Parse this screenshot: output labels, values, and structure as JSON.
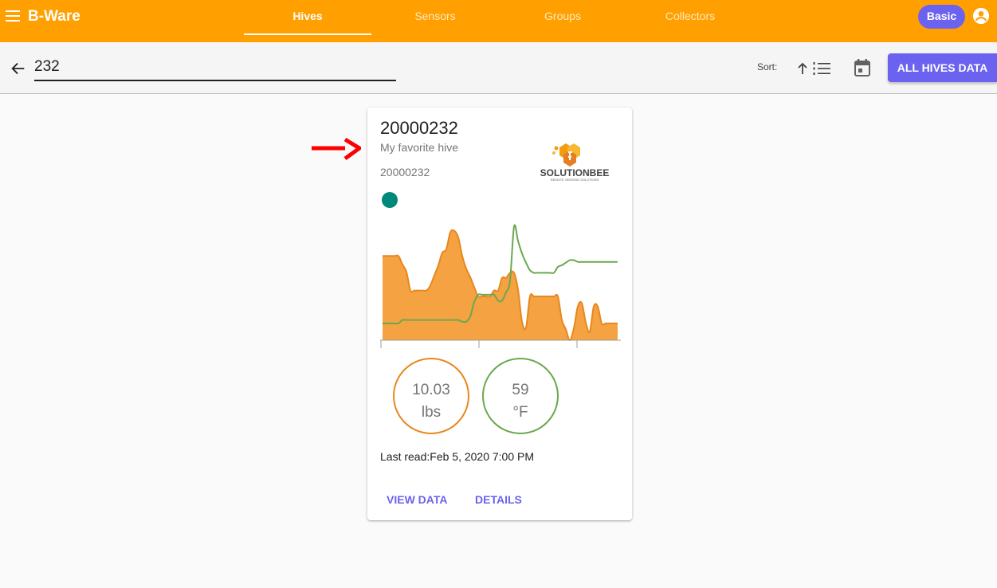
{
  "appbar": {
    "title": "B-Ware",
    "tabs": [
      {
        "label": "Hives",
        "active": true
      },
      {
        "label": "Sensors",
        "active": false
      },
      {
        "label": "Groups",
        "active": false
      },
      {
        "label": "Collectors",
        "active": false
      }
    ],
    "plan_badge": "Basic",
    "icons": {
      "menu": "menu-icon",
      "account": "account-circle-icon"
    },
    "colors": {
      "bar": "#ffa000",
      "accent": "#6b63ef"
    }
  },
  "toolbar": {
    "search_value": "232",
    "sort_label": "Sort:",
    "all_hives_label": "ALL HIVES DATA",
    "icons": {
      "back": "arrow-left-icon",
      "sort_direction": "arrow-up-icon",
      "sort_field": "sort-list-icon",
      "date": "calendar-icon"
    }
  },
  "hive_card": {
    "title": "20000232",
    "subtitle": "My favorite hive",
    "code": "20000232",
    "logo_brand": "SOLUTIONBEE",
    "logo_tagline": "REMOTE SENSING SOLUTIONS",
    "status_color": "#00897b",
    "weight": {
      "value": "10.03",
      "unit": "lbs",
      "color": "#e8871d"
    },
    "temperature": {
      "value": "59",
      "unit": "°F",
      "color": "#6aa84f"
    },
    "last_read_label": "Last read:",
    "last_read_value": "Feb 5, 2020 7:00 PM",
    "actions": {
      "view_data": "VIEW DATA",
      "details": "DETAILS"
    }
  },
  "chart_data": {
    "type": "area",
    "x": [
      0,
      1,
      2,
      3,
      4,
      5,
      6,
      7,
      8,
      9,
      10,
      11,
      12,
      13,
      14,
      15,
      16,
      17,
      18,
      19,
      20,
      21,
      22,
      23,
      24,
      25,
      26,
      27,
      28,
      29,
      30,
      31,
      32,
      33,
      34,
      35,
      36,
      37,
      38,
      39,
      40,
      41,
      42,
      43,
      44,
      45,
      46,
      47,
      48,
      49,
      50,
      51,
      52,
      53,
      54,
      55,
      56,
      57,
      58,
      59
    ],
    "series": [
      {
        "values": [
          100,
          100,
          100,
          100,
          100,
          90,
          81,
          59,
          59,
          59,
          59,
          59,
          65,
          77,
          89,
          104,
          108,
          128,
          130,
          122,
          100,
          85,
          75,
          63,
          52,
          52,
          52,
          52,
          59,
          59,
          74,
          74,
          80,
          80,
          60,
          22,
          15,
          52,
          52,
          52,
          52,
          52,
          52,
          52,
          52,
          24,
          13,
          0,
          14,
          40,
          44,
          21,
          10,
          40,
          40,
          20,
          20,
          20,
          20,
          20
        ],
        "color": "#e8871d",
        "fill": "#f5a243"
      },
      {
        "values": [
          20,
          20,
          20,
          20,
          20,
          24,
          24,
          24,
          24,
          24,
          24,
          24,
          24,
          24,
          24,
          24,
          24,
          24,
          24,
          24,
          22,
          22,
          28,
          45,
          54,
          54,
          54,
          54,
          54,
          47,
          47,
          57,
          71,
          135,
          118,
          103,
          92,
          83,
          80,
          80,
          80,
          80,
          80,
          80,
          87,
          89,
          92,
          95,
          95,
          93,
          93,
          93,
          93,
          93,
          93,
          93,
          93,
          93,
          93,
          93
        ],
        "color": "#6aa84f",
        "fill": "none"
      }
    ],
    "ylim": [
      0,
      140
    ],
    "x_ticks": 3,
    "grid": false
  }
}
